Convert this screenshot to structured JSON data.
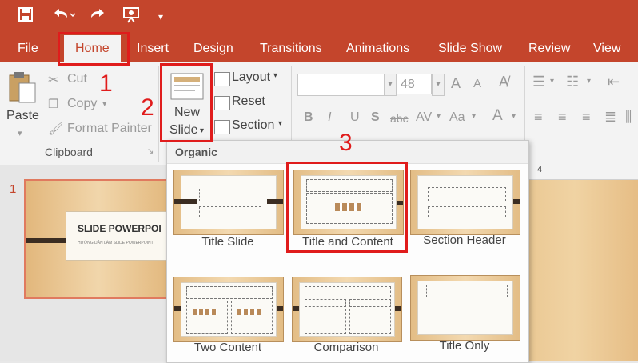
{
  "quick_access": {
    "icons": [
      "save-icon",
      "undo-icon",
      "redo-icon",
      "presenter-icon",
      "customize-icon"
    ]
  },
  "tabs": [
    "File",
    "Home",
    "Insert",
    "Design",
    "Transitions",
    "Animations",
    "Slide Show",
    "Review",
    "View"
  ],
  "ribbon": {
    "clipboard": {
      "paste": "Paste",
      "cut": "Cut",
      "copy": "Copy",
      "format_painter": "Format Painter",
      "group_label": "Clipboard"
    },
    "slides": {
      "new_slide_line1": "New",
      "new_slide_line2": "Slide",
      "layout": "Layout",
      "reset": "Reset",
      "section": "Section"
    },
    "font": {
      "size": "48",
      "grow": "A",
      "shrink": "A",
      "bold": "B",
      "italic": "I",
      "underline": "U",
      "shadow": "S",
      "strike": "abc",
      "spacing": "AV",
      "case": "Aa",
      "color": "A"
    }
  },
  "dropdown": {
    "theme_name": "Organic",
    "layouts": [
      "Title Slide",
      "Title and Content",
      "Section Header",
      "Two Content",
      "Comparison",
      "Title Only"
    ]
  },
  "slide_pane": {
    "number": "1",
    "title": "SLIDE POWERPOI",
    "subtitle": "HƯỚNG DẪN LÀM SLIDE POWERPOINT"
  },
  "ruler": {
    "mark": "4"
  },
  "annotations": [
    "1",
    "2",
    "3"
  ],
  "colors": {
    "accent": "#c4452c",
    "highlight": "#e01c1c"
  }
}
